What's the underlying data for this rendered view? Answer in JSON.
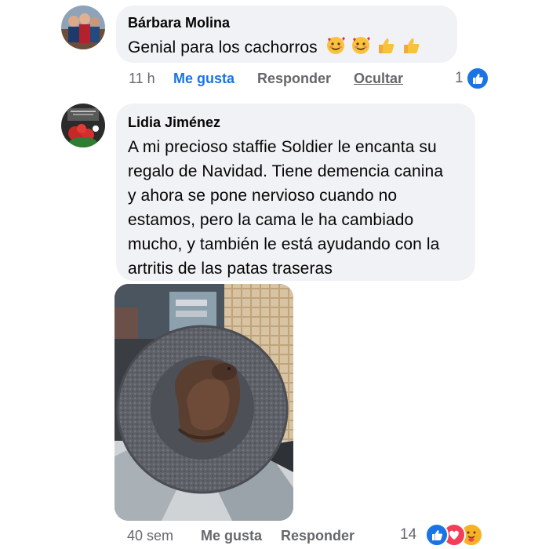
{
  "comments": [
    {
      "author": "Bárbara Molina",
      "text": "Genial para los cachorros",
      "emojis": [
        "smiling-face-with-hearts",
        "smiling-face-with-hearts",
        "thumbs-up",
        "thumbs-up"
      ],
      "time": "11 h",
      "like_label": "Me gusta",
      "reply_label": "Responder",
      "hide_label": "Ocultar",
      "reaction_count": "1",
      "reactions": [
        "like"
      ]
    },
    {
      "author": "Lidia Jiménez",
      "text_lines": [
        "A mi precioso staffie Soldier le encanta su",
        "regalo de Navidad. Tiene demencia canina",
        "y ahora se pone nervioso cuando no",
        "estamos, pero la cama le ha cambiado",
        "mucho, y también le está ayudando con la",
        "artritis de las patas traseras"
      ],
      "time": "40 sem",
      "like_label": "Me gusta",
      "reply_label": "Responder",
      "reaction_count": "14",
      "reactions": [
        "like",
        "love",
        "care"
      ]
    }
  ],
  "colors": {
    "bubble": "#f0f2f5",
    "like_blue": "#1b74e4",
    "meta_gray": "#65676b",
    "love_red": "#f33e58",
    "care_yellow": "#f7b125"
  }
}
